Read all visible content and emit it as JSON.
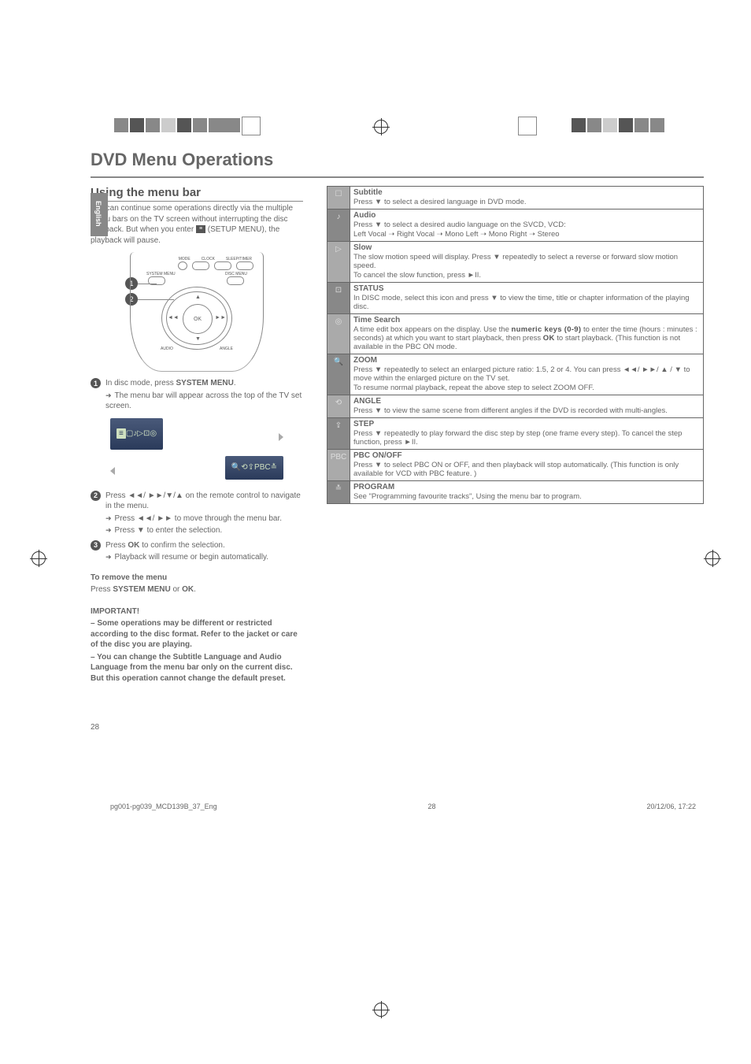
{
  "page": {
    "language_tab": "English",
    "title": "DVD Menu Operations",
    "page_number": "28"
  },
  "section": {
    "heading": "Using the menu bar",
    "intro": "You can continue some operations directly via the multiple menu bars on the TV screen without interrupting the disc playback. But when you enter",
    "intro_after_icon": "(SETUP MENU), the playback will pause.",
    "setup_icon_glyph": "≡"
  },
  "remote": {
    "top_labels": [
      "MODE",
      "CLOCK",
      "SLEEP/TIMER"
    ],
    "mid_left": "SYSTEM MENU",
    "mid_right": "DISC MENU",
    "center": "OK",
    "bottom_left": "AUDIO",
    "bottom_right": "ANGLE",
    "arrows": {
      "left": "◄◄",
      "right": "►►",
      "up": "▲",
      "down": "▼"
    },
    "callout1": "1",
    "callout2": "2"
  },
  "steps": {
    "s1": {
      "num": "1",
      "text_a": "In disc mode, press ",
      "text_a_bold": "SYSTEM MENU",
      "text_a_end": ".",
      "bullet": "The menu bar will appear across the top of the TV set screen."
    },
    "s2": {
      "num": "2",
      "text_a": "Press ◄◄/ ►►/▼/▲ on the remote control to navigate in the menu.",
      "bullet1": "Press ◄◄/ ►► to move through the menu bar.",
      "bullet2": "Press ▼ to enter the selection."
    },
    "s3": {
      "num": "3",
      "text_a": "Press ",
      "text_a_bold": "OK",
      "text_a_end": " to confirm the selection.",
      "bullet": "Playback will resume or begin automatically."
    }
  },
  "menubar": {
    "top_icons": [
      "≡",
      "▢",
      "♪",
      "▷",
      "⊡",
      "◎"
    ],
    "bottom_icons": [
      "🔍",
      "⟲",
      "⇪",
      "PBC",
      "≛"
    ]
  },
  "remove": {
    "heading": "To remove the menu",
    "text_a": "Press ",
    "text_bold1": "SYSTEM MENU",
    "text_mid": " or ",
    "text_bold2": "OK",
    "text_end": "."
  },
  "important": {
    "heading": "IMPORTANT!",
    "p1": "–   Some operations may be different or restricted according to the disc format. Refer to the jacket or care of the disc you are playing.",
    "p2": "–   You can change the Subtitle Language and Audio Language from the menu bar only on the current disc. But this operation cannot change the default preset."
  },
  "table": [
    {
      "icon": "☐",
      "title": "Subtitle",
      "body": "Press ▼ to select a desired language in DVD mode."
    },
    {
      "icon": "♪",
      "title": "Audio",
      "body": "Press ▼ to select a desired audio language on the SVCD, VCD:\nLeft Vocal ➝ Right Vocal ➝ Mono Left ➝ Mono Right ➝ Stereo"
    },
    {
      "icon": "▷",
      "title": "Slow",
      "body": "The slow motion speed will display. Press ▼ repeatedly to select a reverse or forward slow motion speed.\nTo cancel the slow function, press ►II."
    },
    {
      "icon": "⊡",
      "title": "STATUS",
      "body": "In DISC mode, select this icon and press ▼ to view the time, title or chapter information of the playing disc."
    },
    {
      "icon": "◎",
      "title": "Time Search",
      "body": "A time edit box appears on the display. Use the numeric keys (0-9) to enter the time (hours : minutes : seconds) at which you want to start playback, then press OK to start playback. (This function is not available in the PBC ON mode."
    },
    {
      "icon": "🔍",
      "title": "ZOOM",
      "body": "Press ▼ repeatedly to select an enlarged picture ratio: 1.5, 2 or 4. You can press  ◄◄/ ►►/ ▲ / ▼ to move within the enlarged picture on the TV set.\nTo resume normal playback, repeat the above step to select ZOOM OFF."
    },
    {
      "icon": "⟲",
      "title": "ANGLE",
      "body": "Press ▼ to view the same scene from different angles  if the DVD is recorded with multi-angles."
    },
    {
      "icon": "⇪",
      "title": "STEP",
      "body": "Press ▼ repeatedly to play forward the disc step by step (one frame every step). To cancel the step function, press ►II."
    },
    {
      "icon": "PBC",
      "title": "PBC ON/OFF",
      "body": "Press ▼ to select PBC ON or OFF, and then playback will stop automatically. (This function is only available for VCD with PBC feature. )"
    },
    {
      "icon": "≛",
      "title": "PROGRAM",
      "body": "See \"Programming favourite tracks\", Using the menu bar to program."
    }
  ],
  "table_bold_phrases": {
    "time_search_keys": "numeric keys (0-9)",
    "time_search_ok": "OK"
  },
  "footer": {
    "left": "pg001-pg039_MCD139B_37_Eng",
    "mid": "28",
    "right": "20/12/06, 17:22"
  }
}
